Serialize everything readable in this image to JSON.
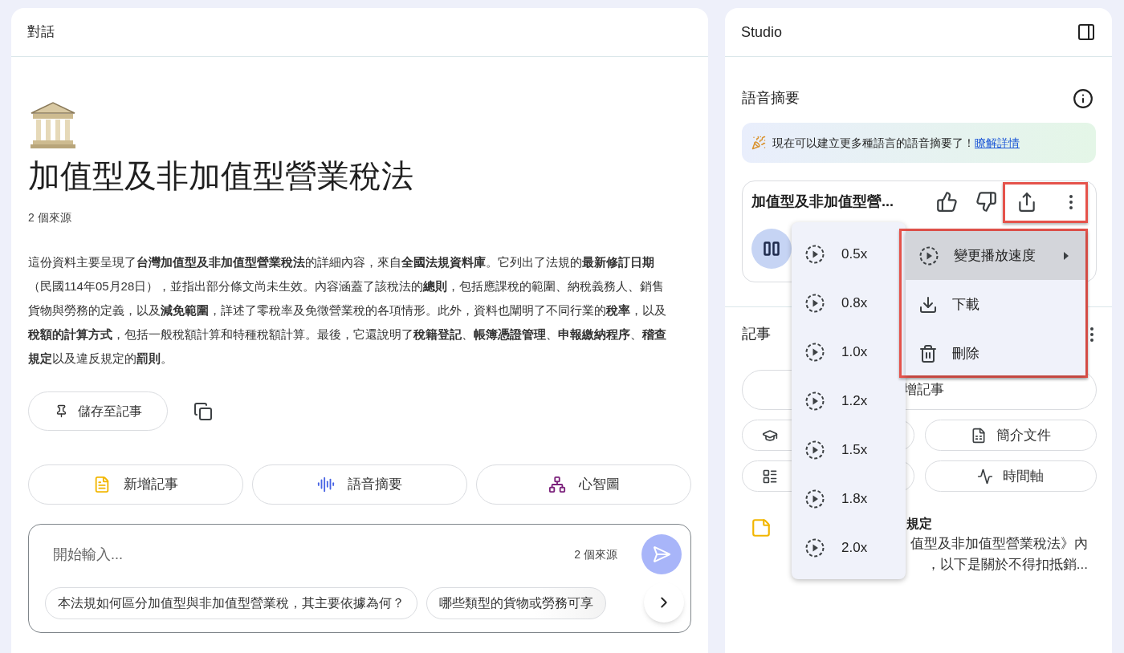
{
  "chat": {
    "title": "對話",
    "heading": "加值型及非加值型營業稅法",
    "source_count": "2 個來源",
    "summary": "這份資料主要呈現了**台灣加值型及非加值型營業稅法**的詳細內容，來自**全國法規資料庫**。它列出了法規的**最新修訂日期**（民國114年05月28日），並指出部分條文尚未生效。內容涵蓋了該稅法的**總則**，包括應課稅的範圍、納稅義務人、銷售貨物與勞務的定義，以及**減免範圍**，詳述了零稅率及免徵營業稅的各項情形。此外，資料也闡明了不同行業的**稅率**，以及**稅額的計算方式**，包括一般稅額計算和特種稅額計算。最後，它還說明了**稅籍登記**、**帳簿憑證管理**、**申報繳納程序**、**稽查規定**以及違反規定的**罰則**。",
    "save_button": "儲存至記事",
    "actions": [
      {
        "label": "新增記事",
        "kind": "note"
      },
      {
        "label": "語音摘要",
        "kind": "audio"
      },
      {
        "label": "心智圖",
        "kind": "mindmap"
      }
    ],
    "composer": {
      "placeholder": "開始輸入...",
      "source_count": "2 個來源",
      "suggestions": [
        "本法規如何區分加值型與非加值型營業稅，其主要依據為何？",
        "哪些類型的貨物或勞務可享"
      ]
    }
  },
  "studio": {
    "title": "Studio",
    "audio_overview": {
      "heading": "語音摘要",
      "banner_text": "現在可以建立更多種語言的語音摘要了！",
      "banner_link": "瞭解詳情",
      "card_title": "加值型及非加值型營..."
    },
    "notes": {
      "heading": "記事",
      "add_button": "增記事",
      "tools": [
        {
          "label": "簡介文件",
          "kind": "briefing"
        },
        {
          "label": "時間軸",
          "kind": "timeline"
        }
      ],
      "note": {
        "title": "規定",
        "lines": [
          "值型及非加值型營業稅法》內",
          "，以下是關於不得扣抵銷..."
        ]
      }
    }
  },
  "speed_menu": {
    "items": [
      "0.5x",
      "0.8x",
      "1.0x",
      "1.2x",
      "1.5x",
      "1.8x",
      "2.0x"
    ]
  },
  "context_menu": {
    "items": [
      {
        "label": "變更播放速度",
        "kind": "speed",
        "selected": true
      },
      {
        "label": "下載",
        "kind": "download",
        "selected": false
      },
      {
        "label": "刪除",
        "kind": "delete",
        "selected": false
      }
    ]
  }
}
